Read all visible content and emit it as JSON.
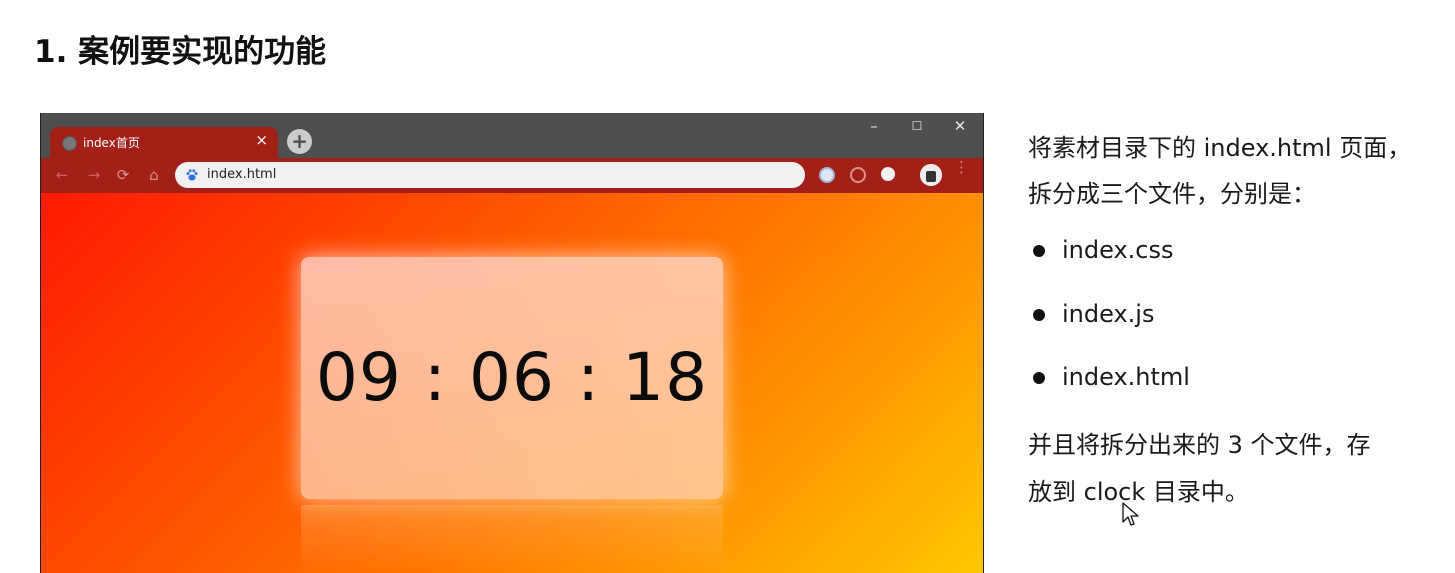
{
  "heading": "1. 案例要实现的功能",
  "browser": {
    "tab_title": "index首页",
    "tab_close": "×",
    "new_tab": "+",
    "window_controls": {
      "minimize": "–",
      "maximize": "☐",
      "close": "✕"
    },
    "nav": {
      "back": "←",
      "forward": "→",
      "reload": "⟳",
      "home": "⌂"
    },
    "address": "index.html",
    "menu": "⋮",
    "colors": {
      "titlebar": "#4f4f4f",
      "tab_and_toolbar": "#a32018"
    }
  },
  "page": {
    "clock": "09 : 06 : 18",
    "gradient": [
      "#ff1a00",
      "#ffc800"
    ]
  },
  "instructions": {
    "intro_line1": "将素材目录下的 index.html 页面，",
    "intro_line2": "拆分成三个文件，分别是：",
    "files": [
      "index.css",
      "index.js",
      "index.html"
    ],
    "outro_line1": "并且将拆分出来的 3 个文件，存",
    "outro_line2": "放到 clock 目录中。"
  }
}
